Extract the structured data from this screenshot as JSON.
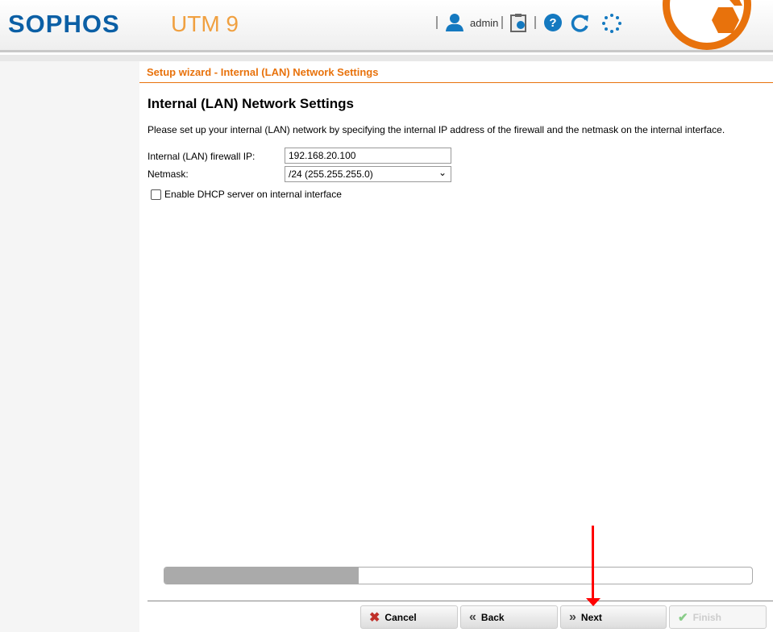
{
  "header": {
    "brand": "SOPHOS",
    "product": "UTM 9",
    "user": "admin",
    "icons": [
      "user-icon",
      "log-viewer-icon",
      "help-icon",
      "reload-icon",
      "spinner-icon"
    ]
  },
  "wizard": {
    "title": "Setup wizard - Internal (LAN) Network Settings",
    "heading": "Internal (LAN) Network Settings",
    "description": "Please set up your internal (LAN) network by specifying the internal IP address of the firewall and the netmask on the internal interface.",
    "ip_label": "Internal (LAN) firewall IP:",
    "ip_value": "192.168.20.100",
    "netmask_label": "Netmask:",
    "netmask_value": "/24 (255.255.255.0)",
    "dhcp_label": "Enable DHCP server on internal interface",
    "dhcp_checked": false,
    "progress_percent": 33
  },
  "buttons": {
    "cancel": "Cancel",
    "back": "Back",
    "next": "Next",
    "finish": "Finish"
  },
  "colors": {
    "accent": "#e8720c",
    "brand": "#0b5fa5"
  }
}
